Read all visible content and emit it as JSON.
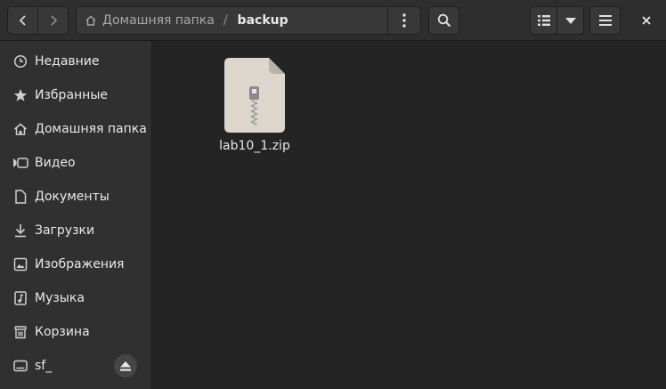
{
  "header": {
    "path": {
      "home_label": "Домашняя папка",
      "separator": "/",
      "current": "backup"
    }
  },
  "sidebar": {
    "items": [
      {
        "label": "Недавние",
        "icon": "clock-icon"
      },
      {
        "label": "Избранные",
        "icon": "star-icon"
      },
      {
        "label": "Домашняя папка",
        "icon": "home-icon"
      },
      {
        "label": "Видео",
        "icon": "video-icon"
      },
      {
        "label": "Документы",
        "icon": "document-icon"
      },
      {
        "label": "Загрузки",
        "icon": "download-icon"
      },
      {
        "label": "Изображения",
        "icon": "image-icon"
      },
      {
        "label": "Музыка",
        "icon": "music-icon"
      },
      {
        "label": "Корзина",
        "icon": "trash-icon"
      },
      {
        "label": "sf_",
        "icon": "drive-icon"
      }
    ]
  },
  "content": {
    "files": [
      {
        "name": "lab10_1.zip",
        "icon": "zip-archive-icon"
      }
    ]
  },
  "colors": {
    "headerbar": "#2e2e2e",
    "sidebar": "#303030",
    "content": "#242424",
    "button": "#383838",
    "file_icon": "#dcd6cd"
  }
}
